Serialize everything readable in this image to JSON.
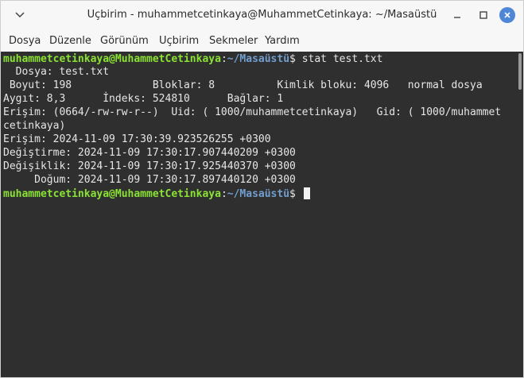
{
  "window": {
    "title": "Uçbirim - muhammetcetinkaya@MuhammetCetinkaya: ~/Masaüstü",
    "colors": {
      "terminal_bg": "#2f2f2f",
      "user_host": "#8ae234",
      "path": "#729fcf",
      "close_button": "#4f86d6"
    }
  },
  "menu": [
    "Dosya",
    "Düzenle",
    "Görünüm",
    "Uçbirim",
    "Sekmeler",
    "Yardım"
  ],
  "terminal": {
    "prompt": {
      "user_host": "muhammetcetinkaya@MuhammetCetinkaya",
      "sep": ":",
      "path": "~/Masaüstü",
      "symbol": "$ "
    },
    "command": "stat test.txt",
    "output": [
      "  Dosya: test.txt",
      " Boyut: 198             Bloklar: 8          Kimlik bloku: 4096   normal dosya",
      "Aygıt: 8,3      İndeks: 524810      Bağlar: 1",
      "Erişim: (0664/-rw-rw-r--)  Uid: ( 1000/muhammetcetinkaya)   Gid: ( 1000/muhammetcetinkaya)",
      "cetinkaya)",
      "Erişim: 2024-11-09 17:30:39.923526255 +0300",
      "Değiştirme: 2024-11-09 17:30:17.907440209 +0300",
      "Değişiklik: 2024-11-09 17:30:17.925440370 +0300",
      "     Doğum: 2024-11-09 17:30:17.897440120 +0300"
    ]
  },
  "icons": {
    "menu": "chevron-down-icon",
    "minimize": "minimize-icon",
    "maximize": "maximize-icon",
    "close": "close-icon"
  }
}
